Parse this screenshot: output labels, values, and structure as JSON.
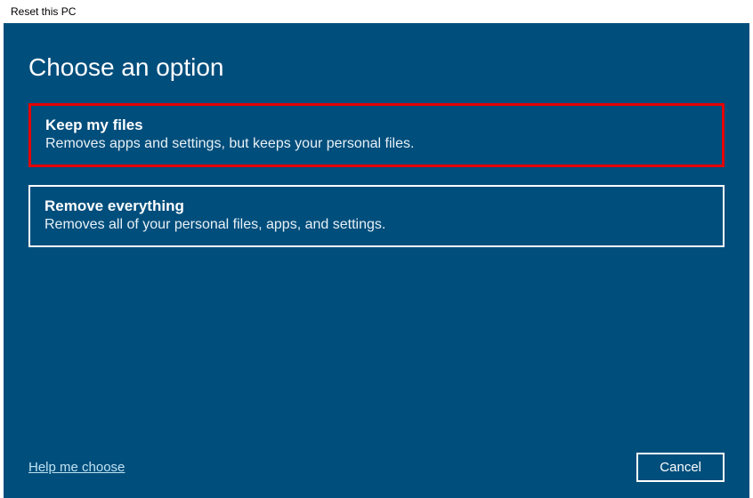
{
  "window": {
    "title": "Reset this PC"
  },
  "heading": "Choose an option",
  "options": {
    "keep": {
      "title": "Keep my files",
      "desc": "Removes apps and settings, but keeps your personal files."
    },
    "remove": {
      "title": "Remove everything",
      "desc": "Removes all of your personal files, apps, and settings."
    }
  },
  "footer": {
    "help": "Help me choose",
    "cancel": "Cancel"
  },
  "colors": {
    "panel": "#004e7c",
    "highlight_border": "#e60000"
  }
}
